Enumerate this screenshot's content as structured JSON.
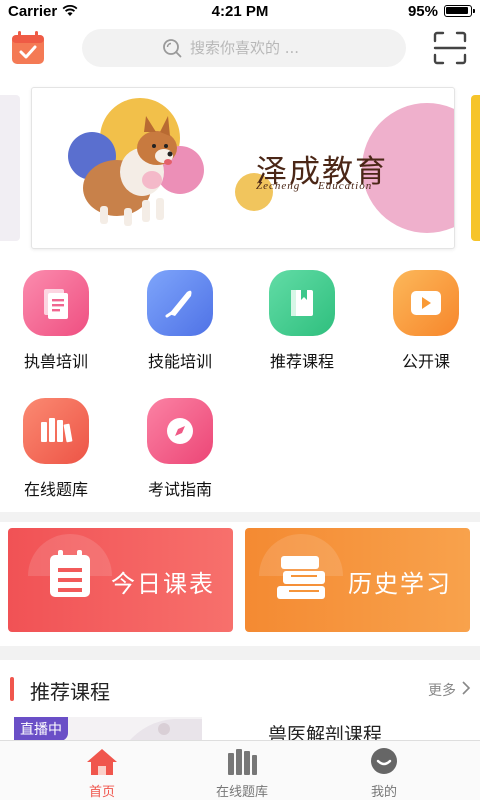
{
  "status_bar": {
    "carrier": "Carrier",
    "time": "4:21 PM",
    "battery": "95%",
    "battery_level": 0.95
  },
  "header": {
    "search_placeholder": "搜索你喜欢的 ..."
  },
  "banner": {
    "title": "泽成教育",
    "subtitle": "Zecheng Education"
  },
  "grid": [
    {
      "label": "执兽培训",
      "icon": "document-icon",
      "color": "#f2618f"
    },
    {
      "label": "技能培训",
      "icon": "scalpel-icon",
      "color": "#5c86ee"
    },
    {
      "label": "推荐课程",
      "icon": "book-icon",
      "color": "#3cc88b"
    },
    {
      "label": "公开课",
      "icon": "play-icon",
      "color": "#f99a36"
    },
    {
      "label": "在线题库",
      "icon": "books-icon",
      "color": "#f0675a"
    },
    {
      "label": "考试指南",
      "icon": "compass-icon",
      "color": "#f05a86"
    }
  ],
  "cards": [
    {
      "label": "今日课表",
      "icon": "calendar-icon",
      "color": "#f25a5a"
    },
    {
      "label": "历史学习",
      "icon": "books-stack-icon",
      "color": "#f6953a"
    }
  ],
  "section": {
    "title": "推荐课程",
    "more": "更多"
  },
  "course": {
    "badge": "直播中",
    "title": "兽医解剖课程"
  },
  "tabs": [
    {
      "label": "首页",
      "icon": "home-icon",
      "active": true
    },
    {
      "label": "在线题库",
      "icon": "books-icon",
      "active": false
    },
    {
      "label": "我的",
      "icon": "user-icon",
      "active": false
    }
  ],
  "colors": {
    "accent": "#f0564d",
    "tab_inactive": "#888888"
  }
}
